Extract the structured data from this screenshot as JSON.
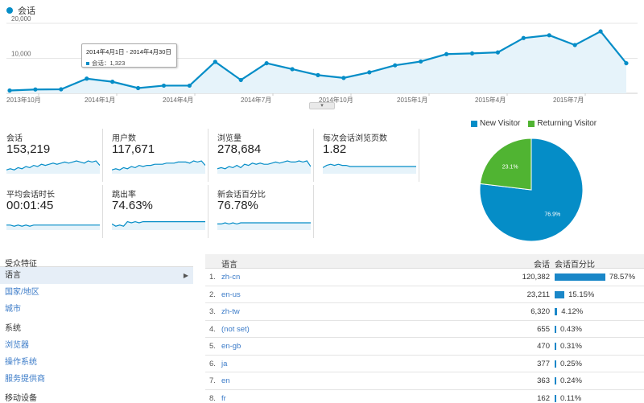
{
  "main_chart": {
    "legend": "会话",
    "y_ticks": [
      "20,000",
      "10,000"
    ],
    "x_ticks": [
      "2013年10月",
      "2014年1月",
      "2014年4月",
      "2014年7月",
      "2014年10月",
      "2015年1月",
      "2015年4月",
      "2015年7月"
    ],
    "tooltip": {
      "range": "2014年4月1日 - 2014年4月30日",
      "value": "会话：1,323"
    },
    "color": "#058dc7"
  },
  "chart_data": {
    "type": "area",
    "series": [
      {
        "name": "会话",
        "values": [
          800,
          1100,
          1150,
          4200,
          3300,
          1500,
          2200,
          2200,
          9000,
          3800,
          8600,
          6900,
          5200,
          4400,
          6000,
          8000,
          9100,
          11200,
          11400,
          11700,
          15800,
          16600,
          13800,
          17700,
          8600
        ]
      }
    ],
    "ylim": [
      0,
      20000
    ],
    "x_labels": [
      "2013年10月",
      "2014年1月",
      "2014年4月",
      "2014年7月",
      "2014年10月",
      "2015年1月",
      "2015年4月",
      "2015年7月"
    ]
  },
  "metrics": [
    {
      "label": "会话",
      "value": "153,219",
      "spark": [
        2,
        3,
        2,
        4,
        3,
        5,
        4,
        6,
        5,
        7,
        6,
        7,
        8,
        7,
        8,
        9,
        8,
        9,
        10,
        9,
        8,
        10,
        9,
        10,
        6
      ]
    },
    {
      "label": "用户数",
      "value": "117,671",
      "spark": [
        2,
        3,
        2,
        4,
        3,
        5,
        4,
        6,
        5,
        6,
        6,
        7,
        7,
        7,
        8,
        8,
        8,
        9,
        9,
        9,
        8,
        10,
        9,
        10,
        6
      ]
    },
    {
      "label": "浏览量",
      "value": "278,684",
      "spark": [
        3,
        4,
        3,
        5,
        4,
        6,
        4,
        7,
        6,
        8,
        7,
        8,
        7,
        7,
        8,
        9,
        8,
        9,
        10,
        9,
        9,
        10,
        9,
        10,
        5
      ]
    },
    {
      "label": "每次会话浏览页数",
      "value": "1.82",
      "spark": [
        4,
        6,
        7,
        6,
        7,
        6,
        6,
        5,
        5,
        5,
        5,
        5,
        5,
        5,
        5,
        5,
        5,
        5,
        5,
        5,
        5,
        5,
        5,
        5,
        5
      ]
    },
    {
      "label": "平均会话时长",
      "value": "00:01:45",
      "spark": [
        3,
        3,
        2,
        3,
        2,
        3,
        2,
        3,
        3,
        3,
        3,
        3,
        3,
        3,
        3,
        3,
        3,
        3,
        3,
        3,
        3,
        3,
        3,
        3,
        3
      ]
    },
    {
      "label": "跳出率",
      "value": "74.63%",
      "spark": [
        4,
        2,
        3,
        2,
        6,
        5,
        6,
        5,
        6,
        6,
        6,
        6,
        6,
        6,
        6,
        6,
        6,
        6,
        6,
        6,
        6,
        6,
        6,
        6,
        6
      ]
    },
    {
      "label": "新会话百分比",
      "value": "76.78%",
      "spark": [
        4,
        4,
        5,
        4,
        5,
        4,
        5,
        5,
        5,
        5,
        5,
        5,
        5,
        5,
        5,
        5,
        5,
        5,
        5,
        5,
        5,
        5,
        5,
        5,
        5
      ]
    }
  ],
  "pie": {
    "legend": [
      {
        "name": "New Visitor",
        "color": "#058dc7"
      },
      {
        "name": "Returning Visitor",
        "color": "#50b432"
      }
    ],
    "slices": [
      {
        "name": "New Visitor",
        "value": 76.9,
        "label": "76.9%",
        "color": "#058dc7"
      },
      {
        "name": "Returning Visitor",
        "value": 23.1,
        "label": "23.1%",
        "color": "#50b432"
      }
    ]
  },
  "left_panel": {
    "header": "受众特征",
    "items": [
      "语言",
      "国家/地区",
      "城市"
    ],
    "section2": "系统",
    "items2": [
      "浏览器",
      "操作系统",
      "服务提供商"
    ],
    "section3": "移动设备"
  },
  "table": {
    "headers": {
      "lang": "语言",
      "sessions": "会话",
      "pct": "会话百分比"
    },
    "rows": [
      {
        "idx": "1.",
        "lang": "zh-cn",
        "sessions": "120,382",
        "pct": "78.57%",
        "ratio": 0.7857
      },
      {
        "idx": "2.",
        "lang": "en-us",
        "sessions": "23,211",
        "pct": "15.15%",
        "ratio": 0.1515
      },
      {
        "idx": "3.",
        "lang": "zh-tw",
        "sessions": "6,320",
        "pct": "4.12%",
        "ratio": 0.0412
      },
      {
        "idx": "4.",
        "lang": "(not set)",
        "sessions": "655",
        "pct": "0.43%",
        "ratio": 0.0043
      },
      {
        "idx": "5.",
        "lang": "en-gb",
        "sessions": "470",
        "pct": "0.31%",
        "ratio": 0.0031
      },
      {
        "idx": "6.",
        "lang": "ja",
        "sessions": "377",
        "pct": "0.25%",
        "ratio": 0.0025
      },
      {
        "idx": "7.",
        "lang": "en",
        "sessions": "363",
        "pct": "0.24%",
        "ratio": 0.0024
      },
      {
        "idx": "8.",
        "lang": "fr",
        "sessions": "162",
        "pct": "0.11%",
        "ratio": 0.0011
      }
    ]
  }
}
